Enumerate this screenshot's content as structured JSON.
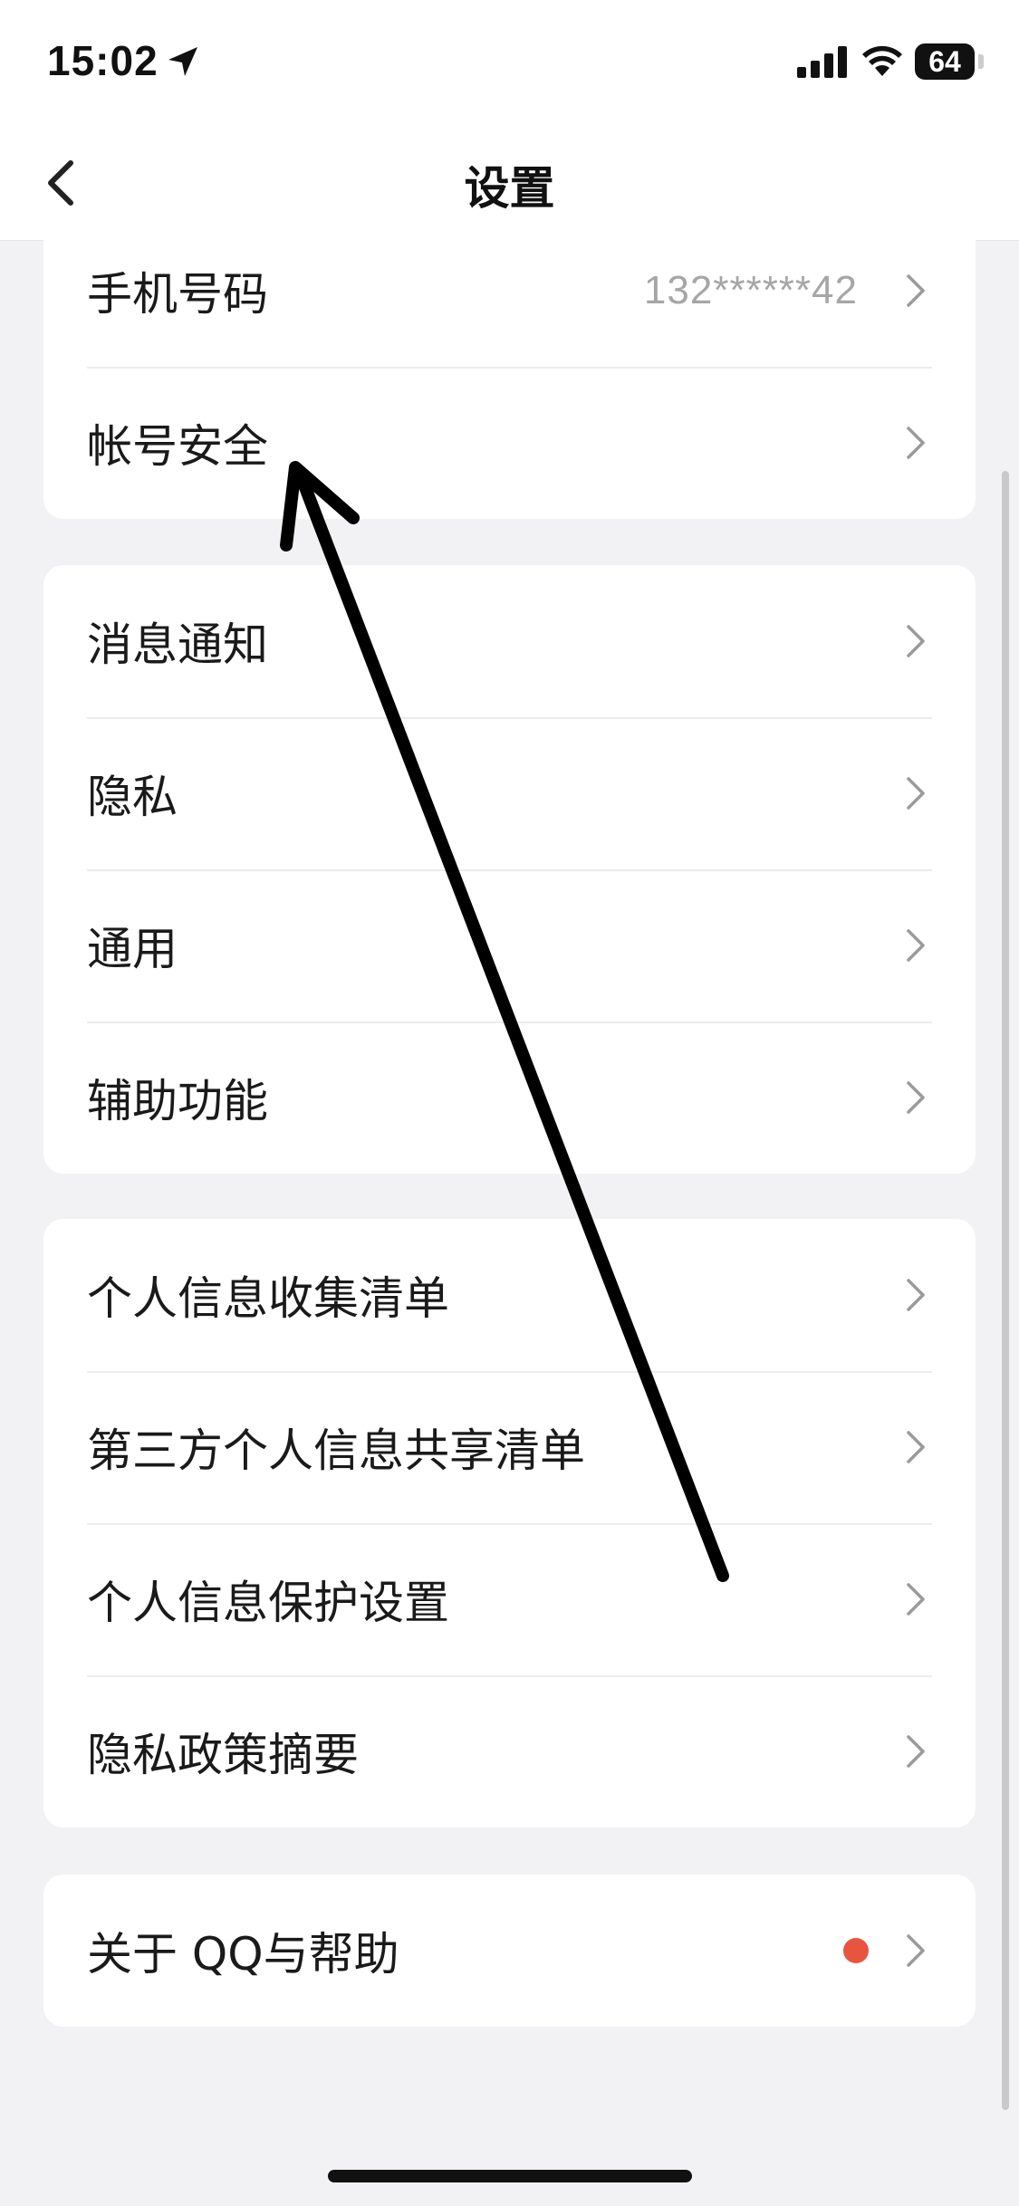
{
  "status_bar": {
    "time": "15:02",
    "battery": "64",
    "icons": [
      "location-arrow-icon",
      "cellular-signal-icon",
      "wifi-icon",
      "battery-icon"
    ]
  },
  "header": {
    "title": "设置",
    "back_icon": "chevron-left-icon"
  },
  "groups": [
    {
      "items": [
        {
          "label": "手机号码",
          "value": "132******42"
        },
        {
          "label": "帐号安全"
        }
      ]
    },
    {
      "items": [
        {
          "label": "消息通知"
        },
        {
          "label": "隐私"
        },
        {
          "label": "通用"
        },
        {
          "label": "辅助功能"
        }
      ]
    },
    {
      "items": [
        {
          "label": "个人信息收集清单"
        },
        {
          "label": "第三方个人信息共享清单"
        },
        {
          "label": "个人信息保护设置"
        },
        {
          "label": "隐私政策摘要"
        }
      ]
    },
    {
      "items": [
        {
          "label": "关于 QQ与帮助",
          "badge": "red-dot"
        }
      ]
    }
  ],
  "colors": {
    "background": "#f2f2f4",
    "card": "#ffffff",
    "badge": "#e8553f",
    "secondary_text": "#a6a6a6"
  }
}
